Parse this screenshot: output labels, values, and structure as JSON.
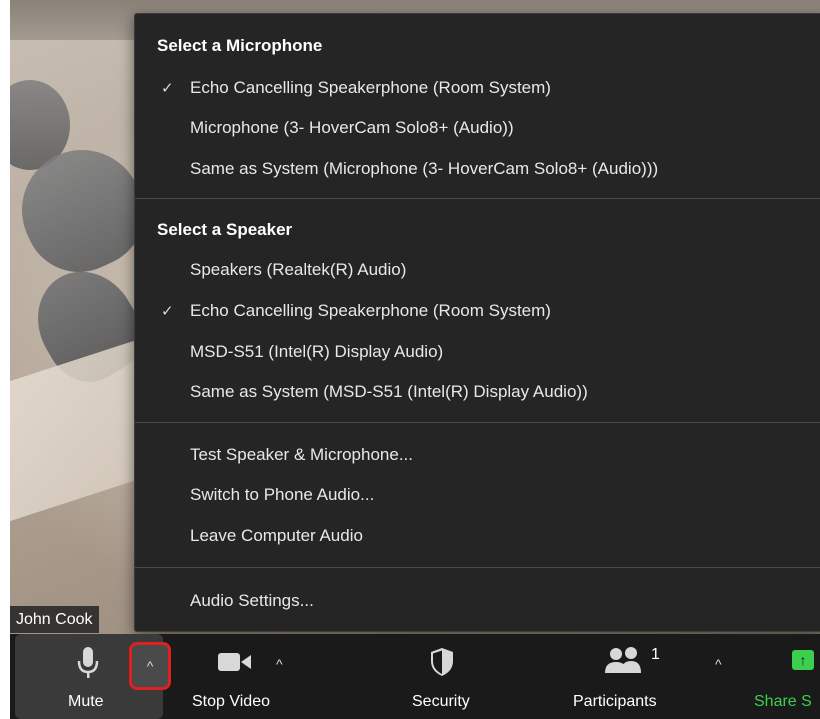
{
  "video": {
    "participant_name": "John Cook"
  },
  "menu": {
    "microphone": {
      "header": "Select a Microphone",
      "items": [
        {
          "label": "Echo Cancelling Speakerphone (Room System)",
          "checked": true
        },
        {
          "label": "Microphone (3- HoverCam Solo8+ (Audio))",
          "checked": false
        },
        {
          "label": "Same as System (Microphone (3- HoverCam Solo8+ (Audio)))",
          "checked": false
        }
      ]
    },
    "speaker": {
      "header": "Select a Speaker",
      "items": [
        {
          "label": "Speakers (Realtek(R) Audio)",
          "checked": false
        },
        {
          "label": "Echo Cancelling Speakerphone (Room System)",
          "checked": true
        },
        {
          "label": "MSD-S51 (Intel(R) Display Audio)",
          "checked": false
        },
        {
          "label": "Same as System (MSD-S51 (Intel(R) Display Audio))",
          "checked": false
        }
      ]
    },
    "actions": [
      {
        "label": "Test Speaker & Microphone..."
      },
      {
        "label": "Switch to Phone Audio..."
      },
      {
        "label": "Leave Computer Audio"
      }
    ],
    "settings": {
      "label": "Audio Settings..."
    },
    "check_glyph": "✓"
  },
  "toolbar": {
    "mute_label": "Mute",
    "stop_video_label": "Stop Video",
    "security_label": "Security",
    "participants_label": "Participants",
    "participants_count": "1",
    "share_label": "Share S",
    "caret_glyph": "^",
    "share_glyph": "↑"
  },
  "colors": {
    "menu_bg": "#252526",
    "toolbar_bg": "#1a1a1a",
    "share_green": "#3ccf4e",
    "highlight_red": "#e02020"
  },
  "icons": {
    "mic": "microphone-icon",
    "camera": "video-camera-icon",
    "shield": "shield-icon",
    "people": "participants-icon",
    "share": "share-screen-icon",
    "caret": "caret-up-icon",
    "check": "checkmark-icon"
  }
}
